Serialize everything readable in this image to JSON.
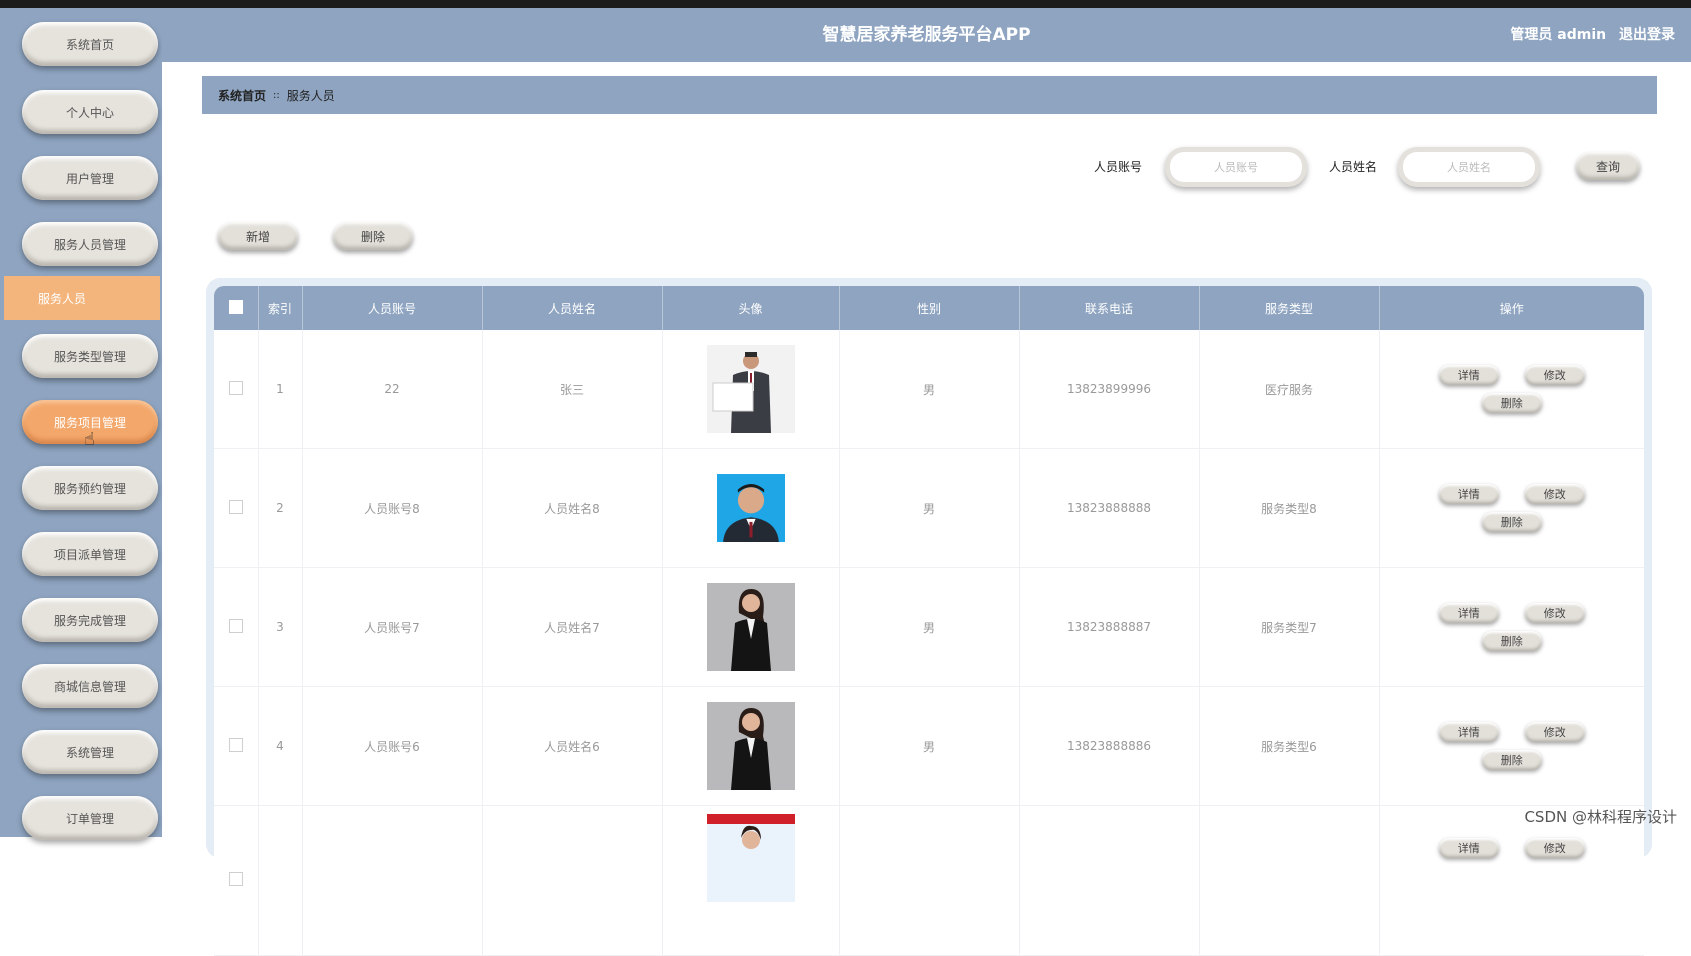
{
  "app": {
    "title": "智慧居家养老服务平台APP",
    "user_label": "管理员 admin",
    "logout_label": "退出登录"
  },
  "sidebar": {
    "items": [
      {
        "label": "系统首页"
      },
      {
        "label": "个人中心"
      },
      {
        "label": "用户管理"
      },
      {
        "label": "服务人员管理"
      },
      {
        "label": "服务人员",
        "active_sub": true
      },
      {
        "label": "服务类型管理"
      },
      {
        "label": "服务项目管理",
        "hover": true
      },
      {
        "label": "服务预约管理"
      },
      {
        "label": "项目派单管理"
      },
      {
        "label": "服务完成管理"
      },
      {
        "label": "商城信息管理"
      },
      {
        "label": "系统管理"
      },
      {
        "label": "订单管理"
      }
    ]
  },
  "breadcrumb": {
    "home": "系统首页",
    "separator": "::",
    "current": "服务人员"
  },
  "search": {
    "account_label": "人员账号",
    "account_placeholder": "人员账号",
    "name_label": "人员姓名",
    "name_placeholder": "人员姓名",
    "query_button": "查询"
  },
  "actions": {
    "add": "新增",
    "delete": "删除"
  },
  "table": {
    "headers": [
      "索引",
      "人员账号",
      "人员姓名",
      "头像",
      "性别",
      "联系电话",
      "服务类型",
      "操作"
    ],
    "row_buttons": {
      "detail": "详情",
      "edit": "修改",
      "delete": "删除"
    },
    "rows": [
      {
        "index": "1",
        "account": "22",
        "name": "张三",
        "gender": "男",
        "phone": "13823899996",
        "service_type": "医疗服务",
        "avatar": "man-holding-sign"
      },
      {
        "index": "2",
        "account": "人员账号8",
        "name": "人员姓名8",
        "gender": "男",
        "phone": "13823888888",
        "service_type": "服务类型8",
        "avatar": "man-id-photo-blue"
      },
      {
        "index": "3",
        "account": "人员账号7",
        "name": "人员姓名7",
        "gender": "男",
        "phone": "13823888887",
        "service_type": "服务类型7",
        "avatar": "woman-business-suit"
      },
      {
        "index": "4",
        "account": "人员账号6",
        "name": "人员姓名6",
        "gender": "男",
        "phone": "13823888886",
        "service_type": "服务类型6",
        "avatar": "woman-business-suit"
      },
      {
        "index": "",
        "account": "",
        "name": "",
        "gender": "",
        "phone": "",
        "service_type": "",
        "avatar": "woman-red-banner"
      }
    ]
  },
  "watermark": "CSDN @林科程序设计",
  "colors": {
    "primary": "#8ea4c0",
    "active": "#f4b57c",
    "button": "#e3e0da"
  }
}
